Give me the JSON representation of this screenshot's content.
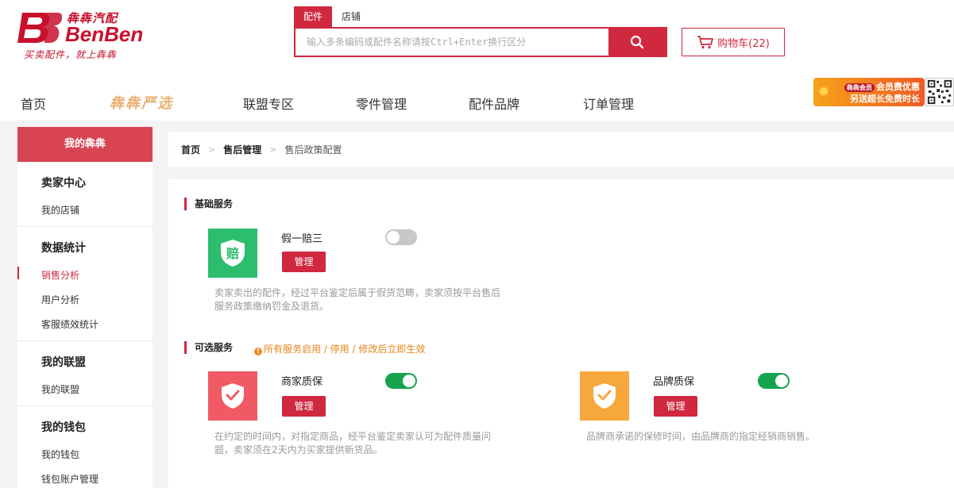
{
  "brand": {
    "name_cn": "犇犇汽配",
    "name_en": "BenBen",
    "slogan": "买卖配件，就上犇犇",
    "primary_color": "#d0283e"
  },
  "search": {
    "tabs": [
      {
        "label": "配件",
        "active": true
      },
      {
        "label": "店铺",
        "active": false
      }
    ],
    "placeholder": "输入多条编码或配件名称请按Ctrl+Enter换行区分",
    "button_icon": "search-icon"
  },
  "cart": {
    "label": "购物车(22)",
    "icon": "cart-icon"
  },
  "nav": {
    "items": [
      "首页",
      "犇犇严选",
      "联盟专区",
      "零件管理",
      "配件品牌",
      "订单管理"
    ]
  },
  "promo": {
    "tag": "犇犇会员",
    "line1": "会员费优惠",
    "line2": "另送超长免费时长"
  },
  "sidebar": {
    "header": "我的犇犇",
    "groups": [
      {
        "title": "卖家中心",
        "items": [
          {
            "label": "我的店铺",
            "active": false
          }
        ]
      },
      {
        "title": "数据统计",
        "items": [
          {
            "label": "销售分析",
            "active": true
          },
          {
            "label": "用户分析",
            "active": false
          },
          {
            "label": "客服绩效统计",
            "active": false
          }
        ]
      },
      {
        "title": "我的联盟",
        "items": [
          {
            "label": "我的联盟",
            "active": false
          }
        ]
      },
      {
        "title": "我的钱包",
        "items": [
          {
            "label": "我的钱包",
            "active": false
          },
          {
            "label": "钱包账户管理",
            "active": false
          }
        ]
      }
    ]
  },
  "breadcrumb": {
    "home": "首页",
    "section": "售后管理",
    "current": "售后政策配置",
    "separator": ">"
  },
  "basic": {
    "title": "基础服务",
    "services": [
      {
        "icon_char": "赔",
        "icon_color": "#2dbd6e",
        "name": "假一赔三",
        "enabled": false,
        "manage_label": "管理",
        "desc_lines": [
          "卖家卖出的配件，经过平台鉴定后属于假货范畴，卖家须按平台售后",
          "服务政策缴纳罚金及退货。"
        ]
      }
    ]
  },
  "optional": {
    "title": "可选服务",
    "note": "所有服务启用 / 停用 / 修改后立即生效",
    "note_icon": "!",
    "services": [
      {
        "icon_color": "#f05a64",
        "name": "商家质保",
        "enabled": true,
        "manage_label": "管理",
        "desc_lines": [
          "在约定的时间内，对指定商品，经平台鉴定卖家认可为配件质量问",
          "题，卖家须在2天内为买家提供新货品。"
        ]
      },
      {
        "icon_color": "#f7a83c",
        "name": "品牌质保",
        "enabled": true,
        "manage_label": "管理",
        "desc_lines": [
          "品牌商承诺的保修时间，由品牌商的指定经销商销售。"
        ]
      }
    ]
  }
}
